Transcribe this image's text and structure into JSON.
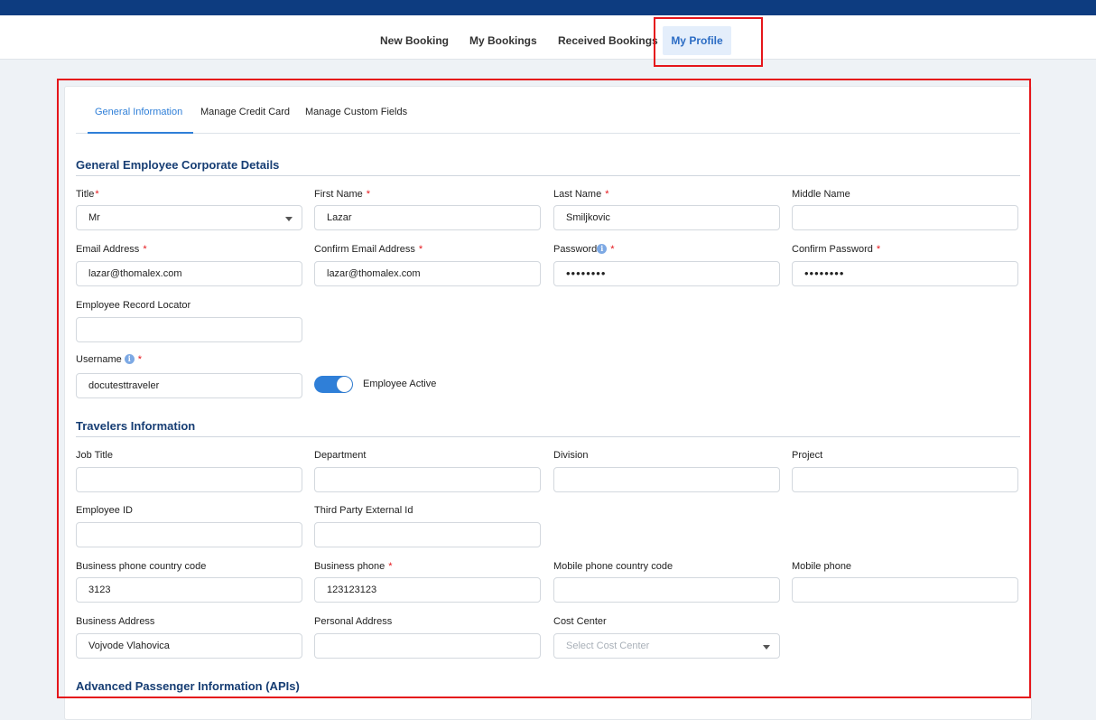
{
  "nav": {
    "items": [
      {
        "label": "New Booking"
      },
      {
        "label": "My Bookings"
      },
      {
        "label": "Received Bookings"
      },
      {
        "label": "My Profile",
        "active": true
      }
    ]
  },
  "tabs": [
    {
      "label": "General Information",
      "active": true
    },
    {
      "label": "Manage Credit Card"
    },
    {
      "label": "Manage Custom Fields"
    }
  ],
  "sections": {
    "general": "General Employee Corporate Details",
    "travelers": "Travelers Information",
    "apis": "Advanced Passenger Information (APIs)"
  },
  "general": {
    "title": {
      "label": "Title",
      "value": "Mr",
      "required": "*"
    },
    "first_name": {
      "label": "First Name",
      "value": "Lazar",
      "required": "*"
    },
    "last_name": {
      "label": "Last Name",
      "value": "Smiljkovic",
      "required": "*"
    },
    "middle_name": {
      "label": "Middle Name",
      "value": ""
    },
    "email": {
      "label": "Email Address",
      "value": "lazar@thomalex.com",
      "required": "*"
    },
    "confirm_email": {
      "label": "Confirm Email Address",
      "value": "lazar@thomalex.com",
      "required": "*"
    },
    "password": {
      "label": "Password",
      "value": "••••••••",
      "required": "*"
    },
    "confirm_password": {
      "label": "Confirm Password",
      "value": "••••••••",
      "required": "*"
    },
    "record_locator": {
      "label": "Employee Record Locator",
      "value": ""
    },
    "username": {
      "label": "Username",
      "value": "docutesttraveler",
      "required": "*"
    },
    "employee_active": {
      "label": "Employee Active",
      "on": true
    }
  },
  "travelers": {
    "job_title": {
      "label": "Job Title",
      "value": ""
    },
    "department": {
      "label": "Department",
      "value": ""
    },
    "division": {
      "label": "Division",
      "value": ""
    },
    "project": {
      "label": "Project",
      "value": ""
    },
    "employee_id": {
      "label": "Employee ID",
      "value": ""
    },
    "third_party_id": {
      "label": "Third Party External Id",
      "value": ""
    },
    "business_cc": {
      "label": "Business phone country code",
      "value": "3123"
    },
    "business_phone": {
      "label": "Business phone",
      "value": "123123123",
      "required": "*"
    },
    "mobile_cc": {
      "label": "Mobile phone country code",
      "value": ""
    },
    "mobile_phone": {
      "label": "Mobile phone",
      "value": ""
    },
    "business_address": {
      "label": "Business Address",
      "value": "Vojvode Vlahovica"
    },
    "personal_address": {
      "label": "Personal Address",
      "value": ""
    },
    "cost_center": {
      "label": "Cost Center",
      "placeholder": "Select Cost Center"
    }
  },
  "icons": {
    "info": "info-icon",
    "caret": "chevron-down-icon"
  },
  "colors": {
    "brand": "#0d3c80",
    "accent": "#2f7fd8",
    "required": "#e5161b",
    "highlight": "#e5161b"
  }
}
